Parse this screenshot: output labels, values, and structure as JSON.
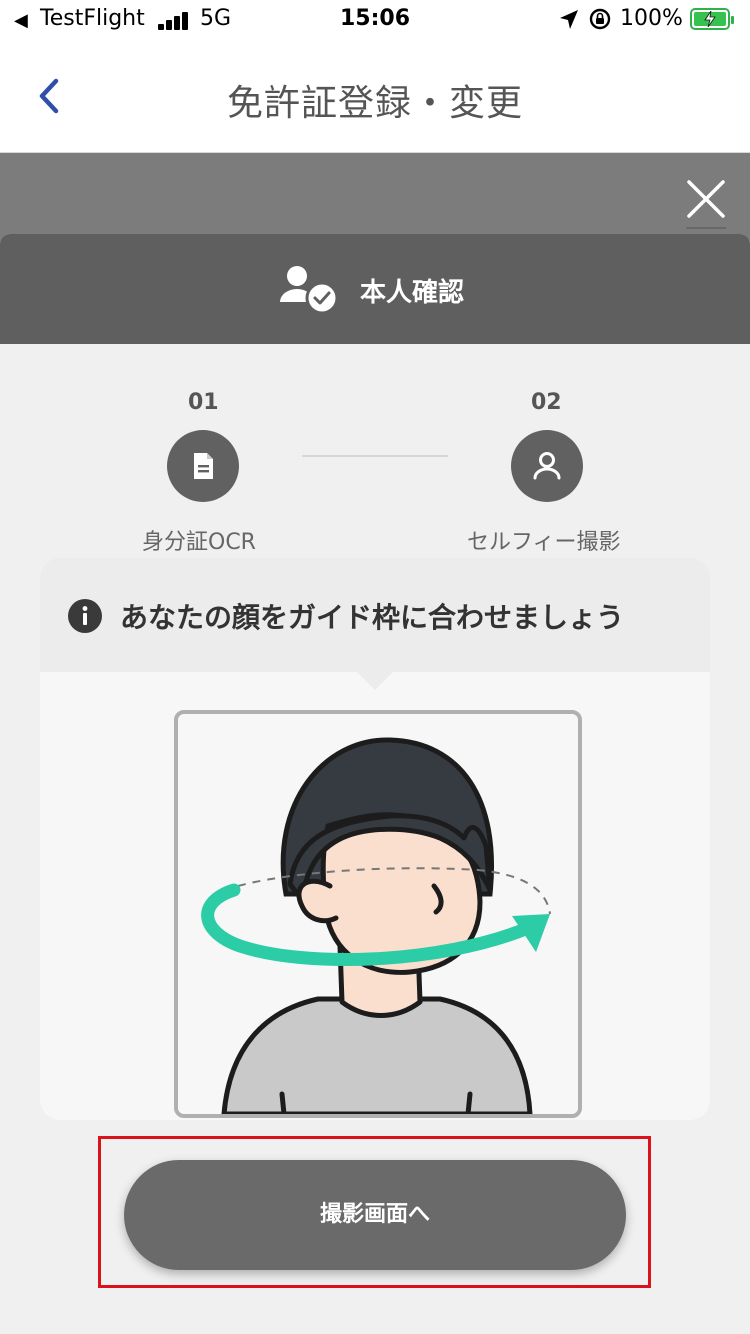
{
  "status_bar": {
    "back_app": "TestFlight",
    "network": "5G",
    "time": "15:06",
    "battery": "100%",
    "battery_color": "#36c24f"
  },
  "nav": {
    "title": "免許証登録・変更",
    "back_icon": "chevron-left-icon",
    "accent": "#2f4fa8"
  },
  "modal": {
    "header_title": "本人確認",
    "header_icon": "user-check-icon",
    "close_icon": "close-icon"
  },
  "steps": [
    {
      "number": "01",
      "label": "身分証OCR",
      "icon": "document-icon"
    },
    {
      "number": "02",
      "label": "セルフィー撮影",
      "icon": "user-icon"
    }
  ],
  "guide": {
    "message": "あなたの顔をガイド枠に合わせましょう",
    "info_icon": "info-icon",
    "arrow_color": "#2ccda6"
  },
  "cta": {
    "label": "撮影画面へ"
  }
}
